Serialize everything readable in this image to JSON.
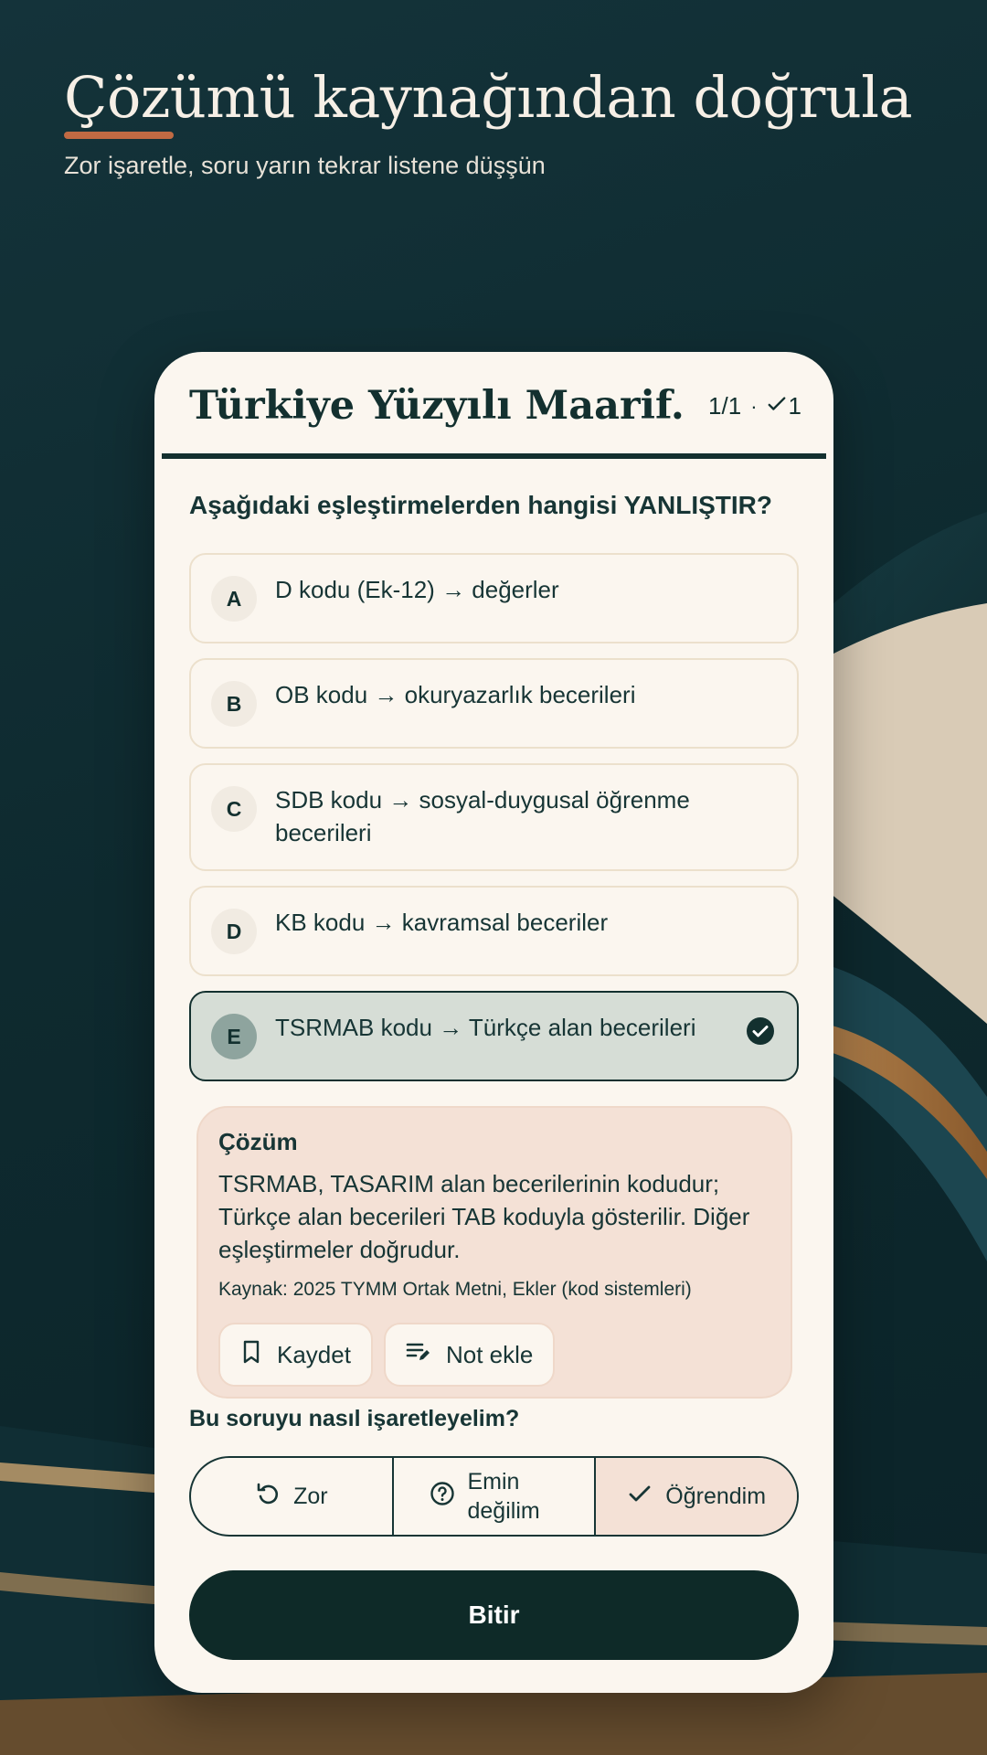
{
  "hero": {
    "title": "Çözümü kaynağından doğrula",
    "subtitle": "Zor işaretle, soru yarın tekrar listene düşşün"
  },
  "card": {
    "title": "Türkiye Yüzyılı Maarif...",
    "counter": "1/1",
    "separator": "·",
    "correct_count": "1",
    "question": "Aşağıdaki eşleştirmelerden hangisi YANLIŞTIR?",
    "options": [
      {
        "letter": "A",
        "text": "D kodu (Ek-12) → değerler"
      },
      {
        "letter": "B",
        "text": "OB kodu → okuryazarlık becerileri"
      },
      {
        "letter": "C",
        "text": "SDB kodu → sosyal-duygusal öğrenme becerileri"
      },
      {
        "letter": "D",
        "text": "KB kodu → kavramsal beceriler"
      },
      {
        "letter": "E",
        "text": "TSRMAB kodu → Türkçe alan becerileri",
        "selected": true
      }
    ],
    "solution": {
      "title": "Çözüm",
      "body": "TSRMAB, TASARIM alan becerilerinin kodudur; Türkçe alan becerileri TAB koduyla gösterilir. Diğer eşleştirmeler doğrudur.",
      "source": "Kaynak: 2025 TYMM Ortak Metni, Ekler (kod sistemleri)",
      "save_label": "Kaydet",
      "note_label": "Not ekle"
    },
    "mark_label": "Bu soruyu nasıl işaretleyelim?",
    "marks": {
      "hard": "Zor",
      "unsure": "Emin değilim",
      "learned": "Öğrendim"
    },
    "finish_label": "Bitir"
  },
  "colors": {
    "background": "#0e2a2e",
    "card": "#fbf6ef",
    "accent": "#c06a43",
    "primary": "#13302f",
    "solution_bg": "#f4e1d6"
  },
  "icons": [
    "check-small-icon",
    "check-circle-icon",
    "bookmark-icon",
    "note-edit-icon",
    "undo-icon",
    "help-circle-icon",
    "check-icon"
  ]
}
